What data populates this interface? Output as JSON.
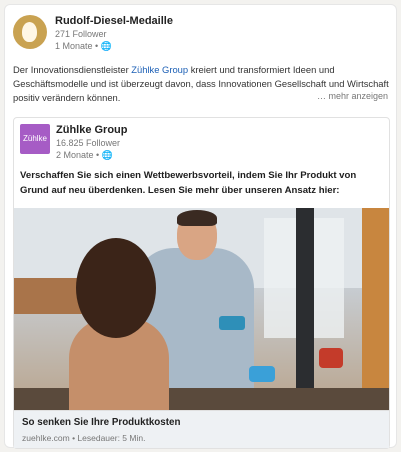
{
  "post": {
    "author": "Rudolf-Diesel-Medaille",
    "followers": "271 Follower",
    "time": "1 Monate •",
    "text_pre": "Der Innovationsdienstleister ",
    "text_link": "Zühlke Group",
    "text_post": " kreiert und transformiert Ideen und Geschäftsmodelle und ist überzeugt davon, dass Innovationen Gesellschaft und Wirtschaft positiv verändern können.",
    "more_label": "… mehr anzeigen"
  },
  "shared": {
    "logo_text": "Zühlke",
    "company": "Zühlke Group",
    "followers": "16.825 Follower",
    "time": "2 Monate •",
    "teaser": "Verschaffen Sie sich einen Wettbewerbsvorteil, indem Sie Ihr Produkt von Grund auf neu überdenken. Lesen Sie mehr über unseren Ansatz hier:",
    "article_title": "So senken Sie Ihre Produktkosten",
    "article_source": "zuehlke.com • Lesedauer: 5 Min."
  },
  "icons": {
    "globe": "globe-icon"
  },
  "colors": {
    "link": "#1b5fb5",
    "zuehlke_brand": "#a65cc5",
    "medal_gold": "#c9a251"
  }
}
